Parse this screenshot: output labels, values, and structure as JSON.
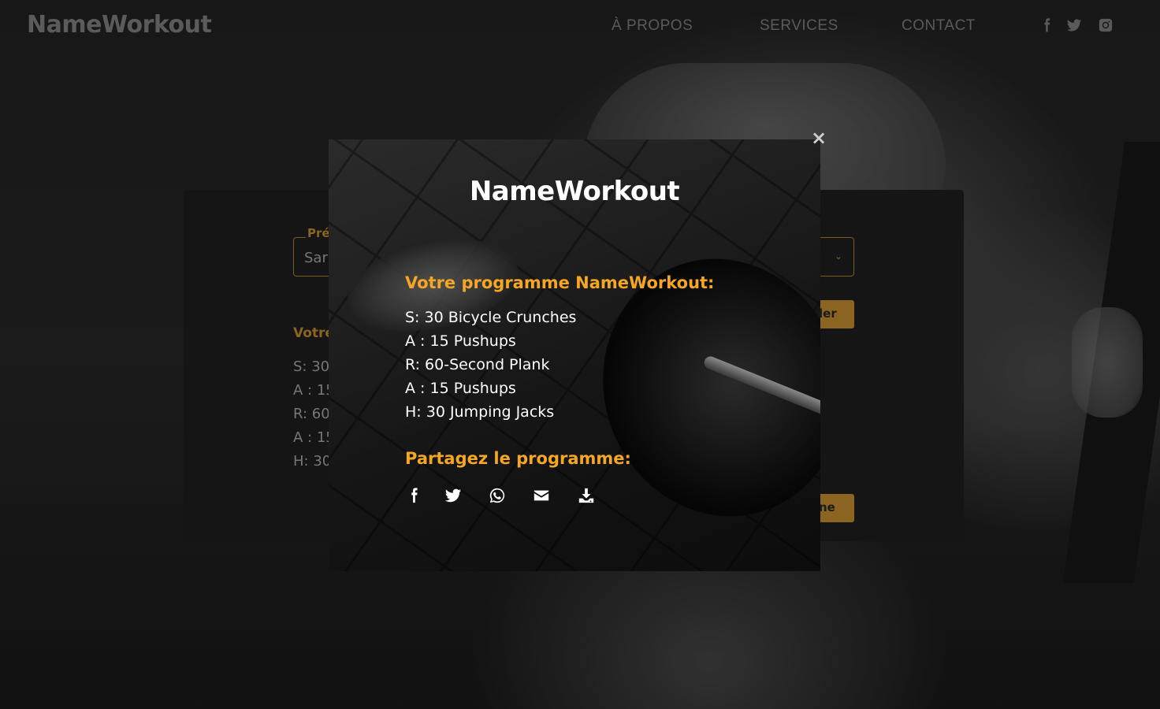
{
  "header": {
    "logo": "NameWorkout",
    "nav": [
      "À PROPOS",
      "SERVICES",
      "CONTACT"
    ],
    "social_icons": [
      "facebook-icon",
      "twitter-icon",
      "instagram-icon"
    ]
  },
  "form": {
    "legend_partial": "Pré",
    "input_value_partial": "Sar",
    "generate_button_partial": "ler",
    "program_title_partial": "Votre",
    "program_partial": [
      "S: 30",
      "A : 15",
      "R: 60",
      "A : 15",
      "H: 30"
    ],
    "share_button_partial": "ne"
  },
  "modal": {
    "close": "×",
    "logo": "NameWorkout",
    "subtitle": "Votre programme NameWorkout:",
    "program": [
      "S: 30 Bicycle Crunches",
      "A : 15 Pushups",
      "R: 60-Second Plank",
      "A : 15 Pushups",
      "H: 30 Jumping Jacks"
    ],
    "share_title": "Partagez le programme:",
    "share_icons": [
      "facebook-icon",
      "twitter-icon",
      "whatsapp-icon",
      "email-icon",
      "download-icon"
    ]
  },
  "colors": {
    "accent": "#f5a623",
    "accent_dim": "#8a6420",
    "nav_text": "#8a8a8a"
  }
}
